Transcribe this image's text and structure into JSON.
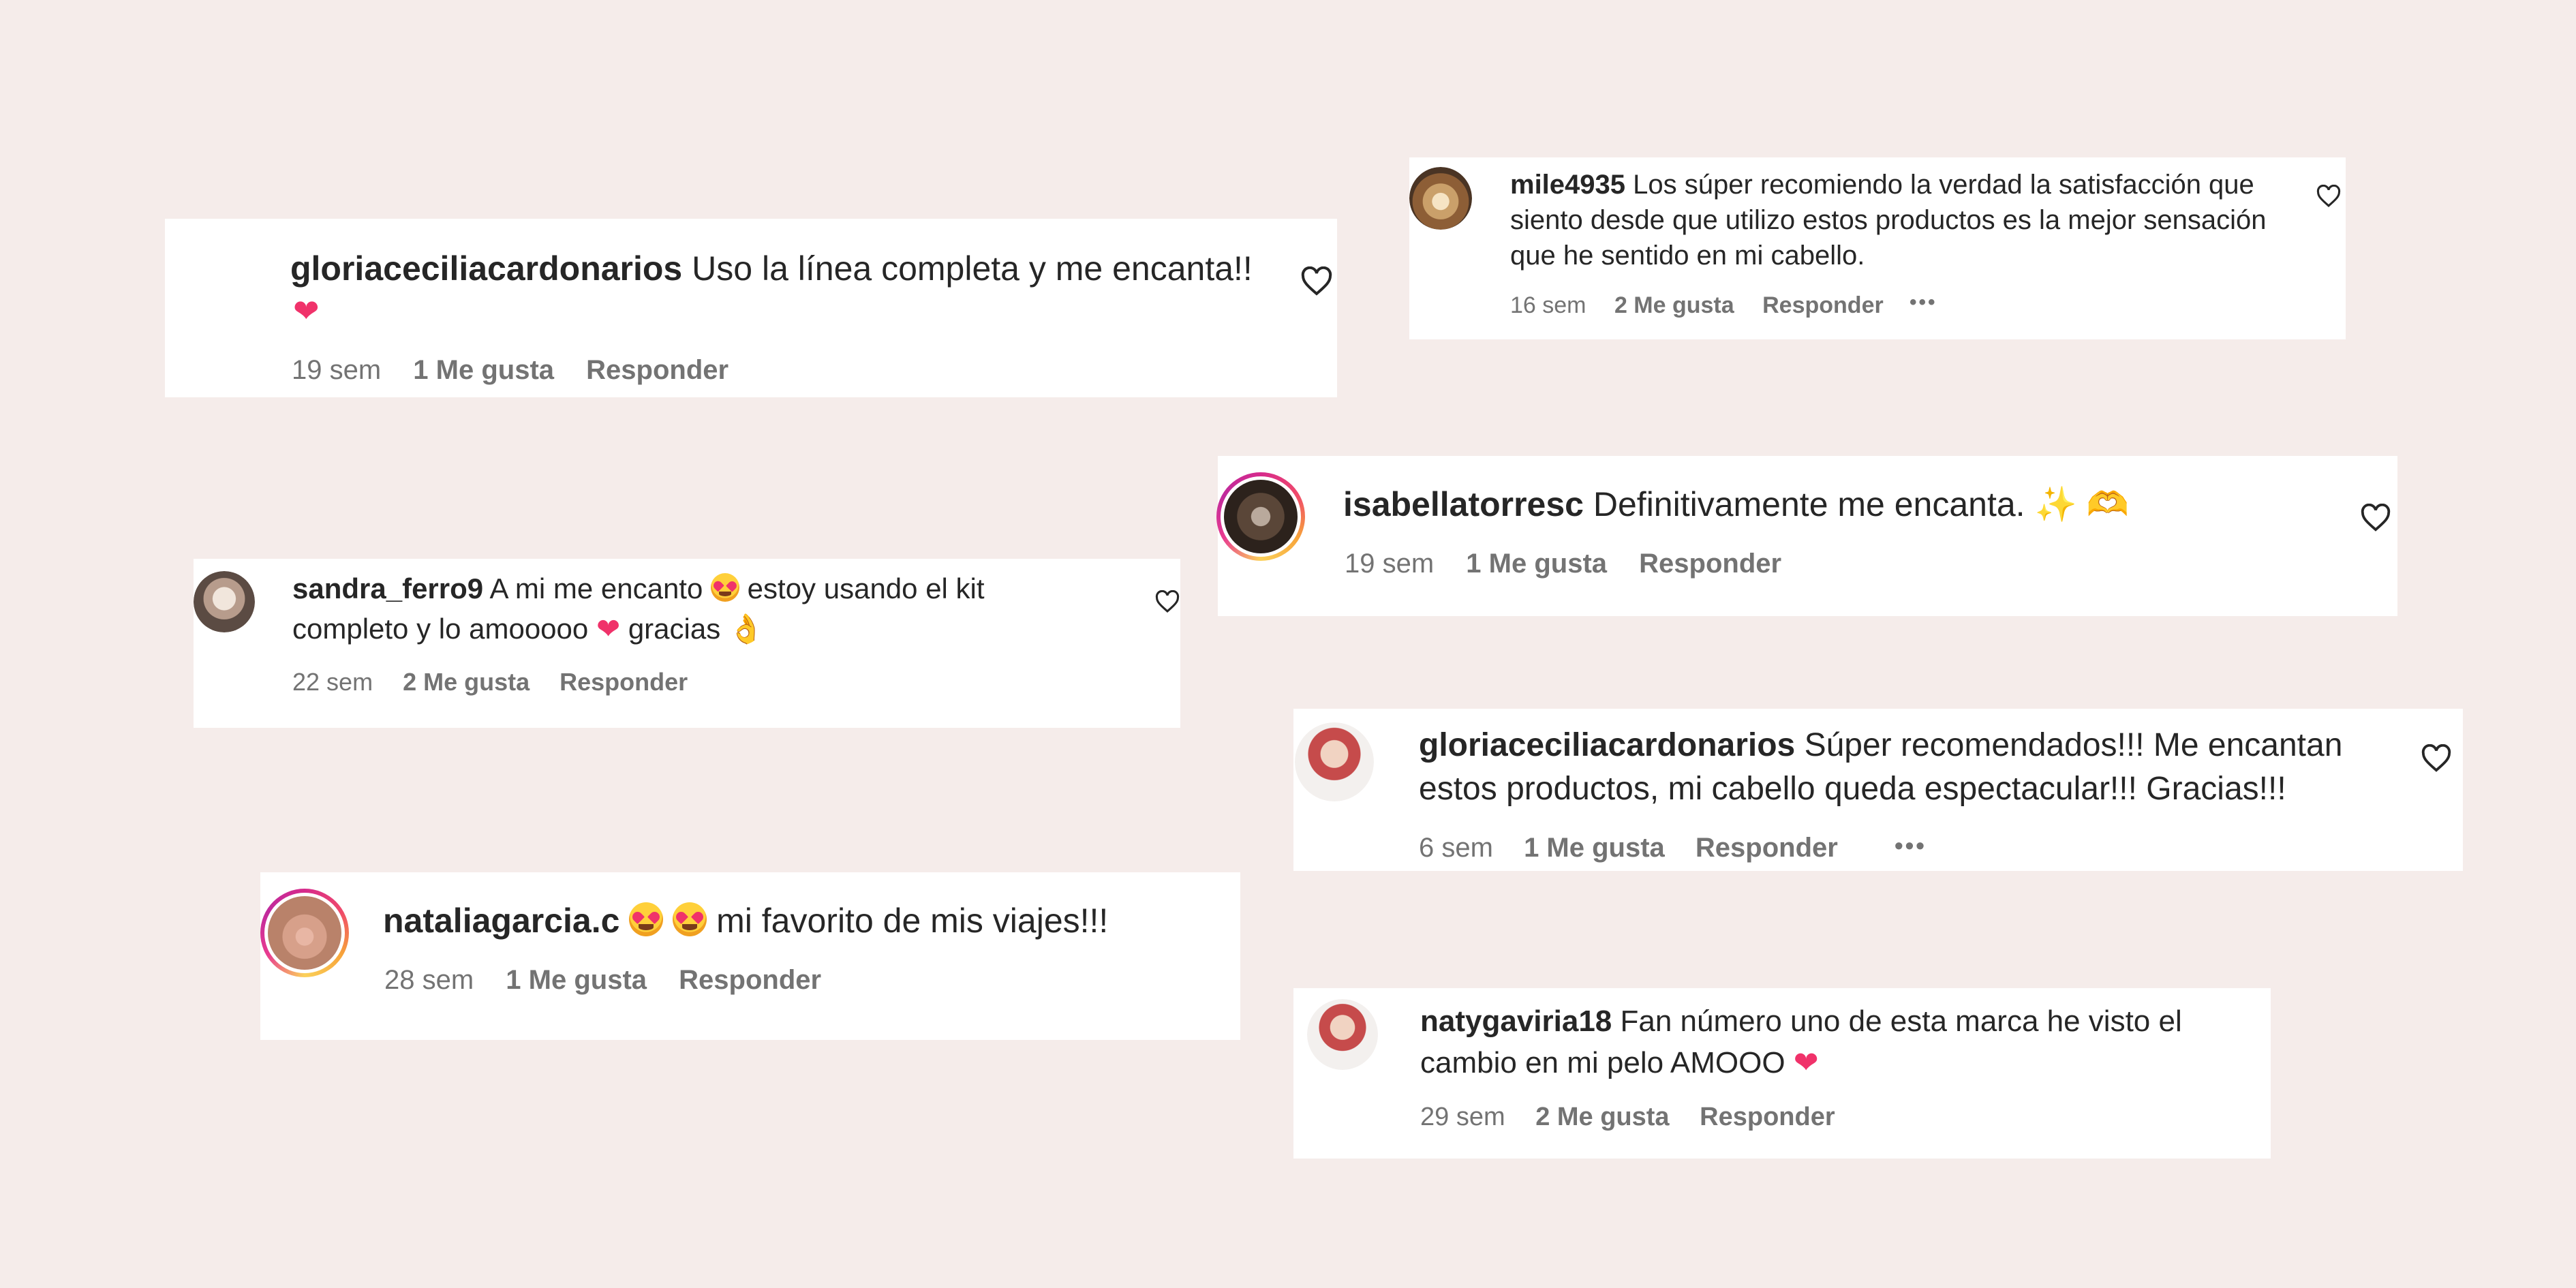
{
  "comments": [
    {
      "username": "gloriaceciliacardonarios",
      "text": "Uso la línea completa y me encanta!!",
      "emoji_line2": "❤",
      "time": "19 sem",
      "likes": "1 Me gusta",
      "reply": "Responder"
    },
    {
      "username": "mile4935",
      "text_line1": "Los súper recomiendo la verdad la satisfacción que",
      "text_line2": "siento desde que utilizo estos productos es la mejor sensación",
      "text_line3": "que he sentido en mi cabello.",
      "time": "16 sem",
      "likes": "2 Me gusta",
      "reply": "Responder",
      "more": "•••"
    },
    {
      "username": "isabellatorresc",
      "text": "Definitivamente me encanta.",
      "emojis": "✨ 🫶",
      "time": "19 sem",
      "likes": "1 Me gusta",
      "reply": "Responder"
    },
    {
      "username": "sandra_ferro9",
      "text_a": "A mi me encanto",
      "text_b": "estoy usando el kit",
      "text_line2a": "completo y lo amooooo",
      "text_line2b": "gracias",
      "time": "22 sem",
      "likes": "2 Me gusta",
      "reply": "Responder"
    },
    {
      "username": "gloriaceciliacardonarios",
      "text_line1": "Súper recomendados!!! Me encantan",
      "text_line2": "estos productos, mi cabello queda espectacular!!! Gracias!!!",
      "time": "6 sem",
      "likes": "1 Me gusta",
      "reply": "Responder",
      "more": "•••"
    },
    {
      "username": "nataliagarcia.c",
      "text": "mi favorito de mis viajes!!!",
      "time": "28 sem",
      "likes": "1 Me gusta",
      "reply": "Responder"
    },
    {
      "username": "natygaviria18",
      "text_line1": "Fan número uno de esta marca he visto el",
      "text_line2": "cambio en mi pelo AMOOO",
      "time": "29 sem",
      "likes": "2 Me gusta",
      "reply": "Responder"
    }
  ],
  "colors": {
    "background": "#f5ecea",
    "card": "#ffffff",
    "text": "#262626",
    "meta": "#737373",
    "heart_emoji": "#f0326a"
  },
  "icons": {
    "like": "heart-outline-icon",
    "more": "more-options-icon"
  }
}
